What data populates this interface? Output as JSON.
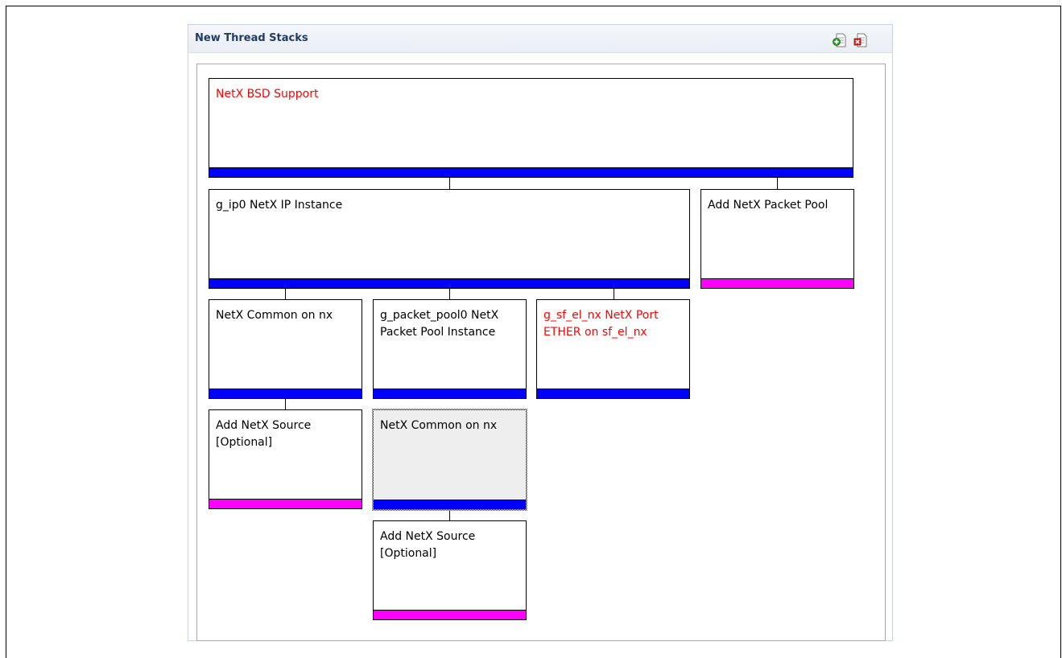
{
  "panel": {
    "title": "New Thread Stacks",
    "icons": [
      "add-stack-icon",
      "remove-stack-icon"
    ]
  },
  "nodes": {
    "bsd": {
      "label": "NetX BSD Support",
      "status": "error",
      "bar": "blue"
    },
    "ip": {
      "label": "g_ip0 NetX IP Instance",
      "status": "ok",
      "bar": "blue"
    },
    "add_pool": {
      "label": "Add NetX Packet Pool",
      "status": "ok",
      "bar": "magenta"
    },
    "common1": {
      "label": "NetX Common on nx",
      "status": "ok",
      "bar": "blue"
    },
    "pool": {
      "label": "g_packet_pool0 NetX Packet Pool Instance",
      "status": "ok",
      "bar": "blue"
    },
    "port": {
      "label": "g_sf_el_nx NetX Port ETHER on sf_el_nx",
      "status": "error",
      "bar": "blue"
    },
    "src1": {
      "label": "Add NetX Source [Optional]",
      "status": "ok",
      "bar": "magenta"
    },
    "common2": {
      "label": "NetX Common on nx",
      "status": "ok",
      "bar": "blue",
      "selected": true
    },
    "src2": {
      "label": "Add NetX Source [Optional]",
      "status": "ok",
      "bar": "magenta"
    }
  },
  "colors": {
    "bar_blue": "#0000ff",
    "bar_magenta": "#ff00ff",
    "error_text": "#ff0000",
    "title_text": "#1f3b66"
  }
}
